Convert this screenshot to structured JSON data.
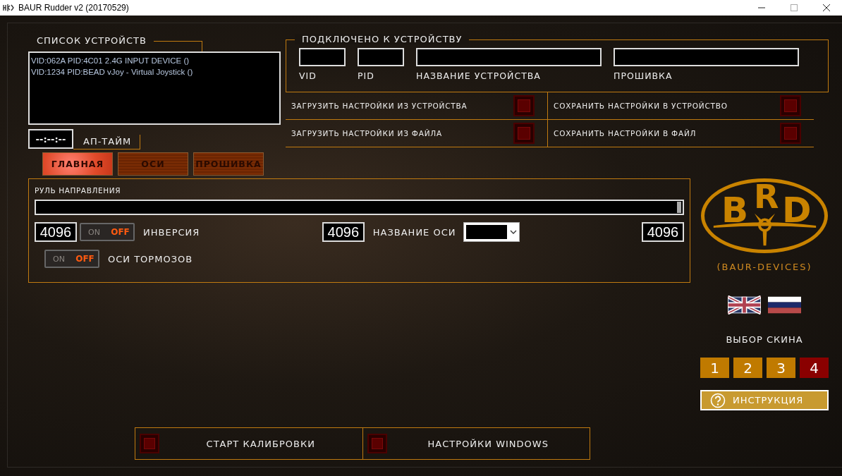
{
  "window": {
    "title": "BAUR Rudder v2 (20170529)"
  },
  "device_list": {
    "title": "СПИСОК УСТРОЙСТВ",
    "items": [
      {
        "text": "VID:062A PID:4C01 2.4G INPUT DEVICE ()",
        "selected": false
      },
      {
        "text": "VID:1234 PID:BEAD vJoy - Virtual Joystick ()",
        "selected": false
      }
    ]
  },
  "uptime": {
    "value": "--:--:--",
    "label": "АП-ТАЙМ"
  },
  "tabs": [
    {
      "label": "ГЛАВНАЯ",
      "selected": true
    },
    {
      "label": "ОСИ",
      "selected": false
    },
    {
      "label": "ПРОШИВКА",
      "selected": false
    }
  ],
  "connected": {
    "title": "ПОДКЛЮЧЕНО К УСТРОЙСТВУ",
    "fields": [
      {
        "label": "VID",
        "kind": "small"
      },
      {
        "label": "PID",
        "kind": "small"
      },
      {
        "label": "НАЗВАНИЕ УСТРОЙСТВА",
        "kind": "wide"
      },
      {
        "label": "ПРОШИВКА",
        "kind": "wide"
      }
    ]
  },
  "settings_actions": [
    {
      "label": "ЗАГРУЗИТЬ НАСТРОЙКИ ИЗ УСТРОЙСТВА"
    },
    {
      "label": "СОХРАНИТЬ НАСТРОЙКИ В УСТРОЙСТВО"
    },
    {
      "label": "ЗАГРУЗИТЬ НАСТРОЙКИ ИЗ ФАЙЛА"
    },
    {
      "label": "СОХРАНИТЬ НАСТРОЙКИ В ФАЙЛ"
    }
  ],
  "axis_panel": {
    "title": "РУЛЬ НАПРАВЛЕНИЯ",
    "level": 1,
    "min_value": "4096",
    "center_value": "4096",
    "max_value": "4096",
    "axis_name_label": "НАЗВАНИЕ ОСИ",
    "inversion": {
      "label": "ИНВЕРСИЯ",
      "on": false,
      "on_text": "ON",
      "off_text": "OFF"
    },
    "brake": {
      "label": "ОСИ ТОРМОЗОВ",
      "on": false,
      "on_text": "ON",
      "off_text": "OFF"
    }
  },
  "logo": {
    "letters": [
      "B",
      "R",
      "D"
    ],
    "caption": "(BAUR-DEVICES)"
  },
  "languages": [
    {
      "kind": "uk"
    },
    {
      "kind": "ru"
    }
  ],
  "skins": {
    "title": "ВЫБОР СКИНА",
    "options": [
      {
        "label": "1",
        "selected": false
      },
      {
        "label": "2",
        "selected": false
      },
      {
        "label": "3",
        "selected": false
      },
      {
        "label": "4",
        "selected": true
      }
    ]
  },
  "help_button": {
    "label": "ИНСТРУКЦИЯ"
  },
  "bottom_actions": [
    {
      "label": "СТАРТ КАЛИБРОВКИ"
    },
    {
      "label": "НАСТРОЙКИ WINDOWS"
    }
  ]
}
